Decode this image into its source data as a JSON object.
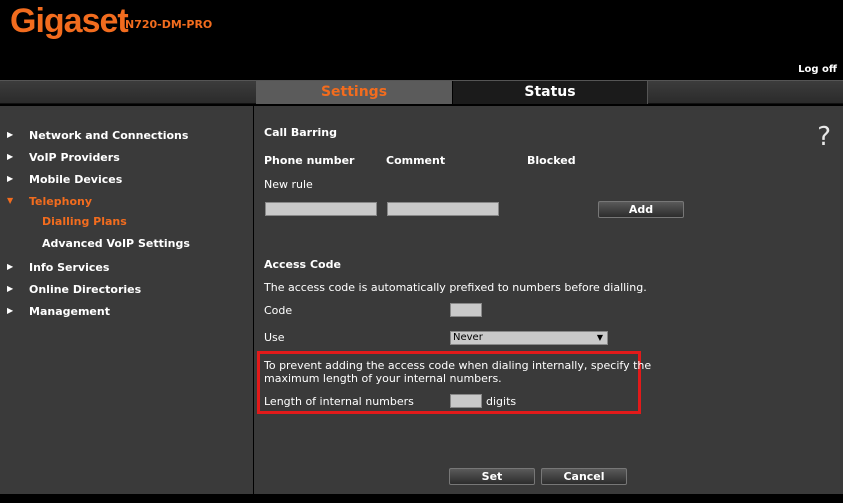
{
  "header": {
    "logo": "Gigaset",
    "model": "N720-DM-PRO",
    "logoff": "Log off"
  },
  "tabs": {
    "settings": "Settings",
    "status": "Status"
  },
  "sidebar": {
    "items": [
      {
        "label": "Network and Connections"
      },
      {
        "label": "VoIP Providers"
      },
      {
        "label": "Mobile Devices"
      },
      {
        "label": "Telephony"
      },
      {
        "label": "Info Services"
      },
      {
        "label": "Online Directories"
      },
      {
        "label": "Management"
      }
    ],
    "sub": [
      {
        "label": "Dialling Plans"
      },
      {
        "label": "Advanced VoIP Settings"
      }
    ]
  },
  "main": {
    "help": "?",
    "call_barring": {
      "title": "Call Barring",
      "col_phone": "Phone number",
      "col_comment": "Comment",
      "col_blocked": "Blocked",
      "new_rule": "New rule",
      "phone_value": "",
      "comment_value": "",
      "add": "Add"
    },
    "access_code": {
      "title": "Access Code",
      "desc": "The access code is automatically prefixed to numbers before dialling.",
      "code_label": "Code",
      "code_value": "",
      "use_label": "Use",
      "use_value": "Never",
      "internal_note_1": "To prevent adding the access code when dialing internally, specify the",
      "internal_note_2": "maximum length of your internal numbers.",
      "length_label": "Length of internal numbers",
      "length_value": "",
      "digits": "digits"
    },
    "set": "Set",
    "cancel": "Cancel"
  }
}
